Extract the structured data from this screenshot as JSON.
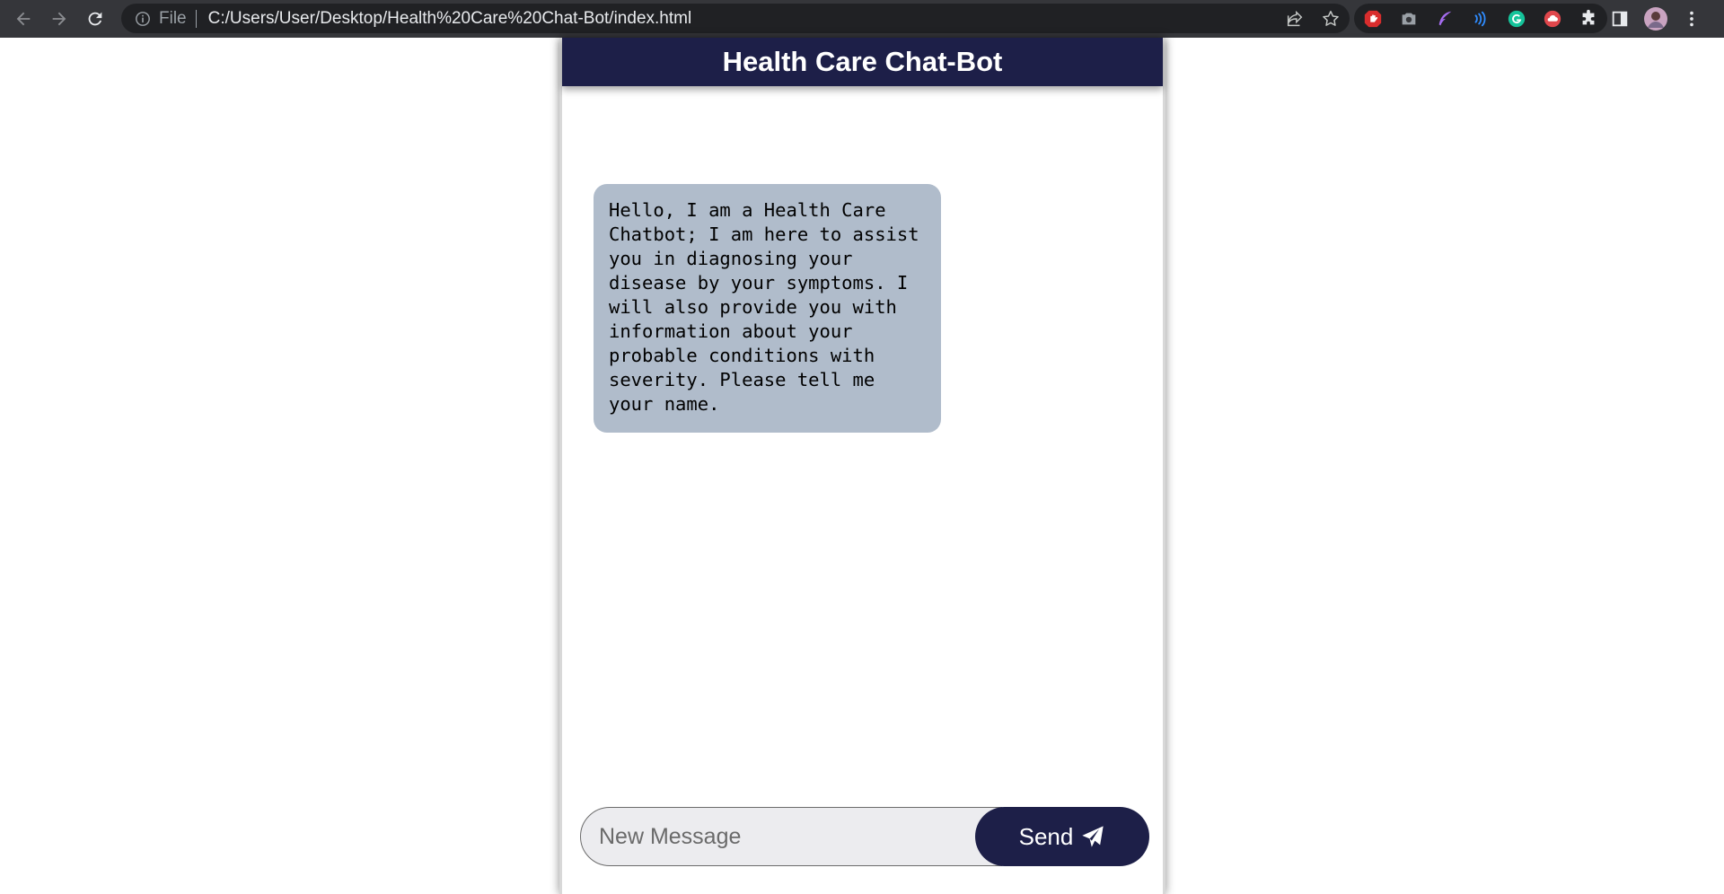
{
  "browser": {
    "scheme_label": "File",
    "url": "C:/Users/User/Desktop/Health%20Care%20Chat-Bot/index.html",
    "icons": {
      "back": "back-arrow-icon",
      "forward": "forward-arrow-icon",
      "reload": "reload-icon",
      "site_info": "info-icon",
      "share": "share-icon",
      "bookmark": "star-icon",
      "extensions": [
        "adblock-hand-icon",
        "camera-icon",
        "feather-pen-icon",
        "wave-icon",
        "grammarly-icon",
        "cloud-upload-icon",
        "puzzle-icon"
      ],
      "side_panel": "side-panel-icon",
      "profile": "profile-avatar-icon",
      "menu": "kebab-menu-icon"
    }
  },
  "chat": {
    "title": "Health Care Chat-Bot",
    "messages": [
      {
        "sender": "bot",
        "text": "Hello, I am a Health Care\nChatbot; I am here to assist\nyou in diagnosing your\ndisease by your symptoms. I\nwill also provide you with\ninformation about your\nprobable conditions with\nseverity. Please tell me\nyour name."
      }
    ],
    "input_placeholder": "New Message",
    "input_value": "",
    "send_label": "Send",
    "send_icon": "paper-plane-icon"
  },
  "colors": {
    "header_bg": "#1d1f48",
    "bot_bubble": "#b0bccb",
    "input_bg": "#ececef",
    "browser_toolbar": "#35363a",
    "omnibox_bg": "#202124"
  }
}
